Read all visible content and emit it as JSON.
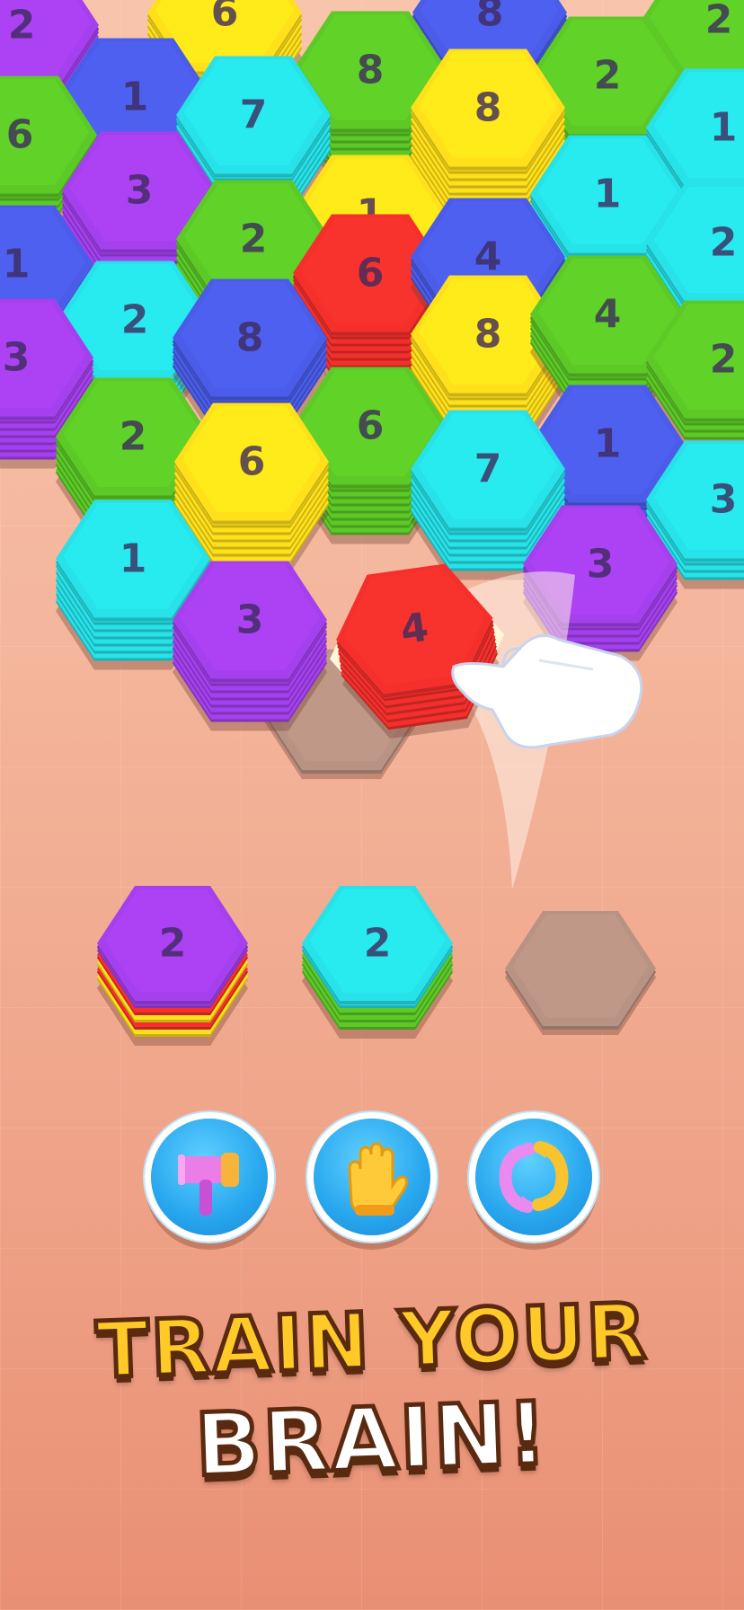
{
  "board": {
    "tiles": [
      {
        "n": "2",
        "c": "purple"
      },
      {
        "n": "6",
        "c": "yellow"
      },
      {
        "n": "8",
        "c": "blue"
      },
      {
        "n": "2",
        "c": "green"
      },
      {
        "n": "1",
        "c": "blue"
      },
      {
        "n": "8",
        "c": "green"
      },
      {
        "n": "2",
        "c": "green"
      },
      {
        "n": "6",
        "c": "green"
      },
      {
        "n": "7",
        "c": "cyan"
      },
      {
        "n": "8",
        "c": "yellow"
      },
      {
        "n": "1",
        "c": "cyan"
      },
      {
        "n": "3",
        "c": "purple"
      },
      {
        "n": "1",
        "c": "cyan"
      },
      {
        "n": "1",
        "c": "yellow"
      },
      {
        "n": "2",
        "c": "cyan"
      },
      {
        "n": "1",
        "c": "blue"
      },
      {
        "n": "2",
        "c": "green"
      },
      {
        "n": "6",
        "c": "red"
      },
      {
        "n": "4",
        "c": "blue"
      },
      {
        "n": "2",
        "c": "cyan"
      },
      {
        "n": "8",
        "c": "blue"
      },
      {
        "n": "8",
        "c": "yellow"
      },
      {
        "n": "4",
        "c": "green"
      },
      {
        "n": "3",
        "c": "purple"
      },
      {
        "n": "2",
        "c": "green"
      },
      {
        "n": "2",
        "c": "green"
      },
      {
        "n": "6",
        "c": "green"
      },
      {
        "n": "1",
        "c": "blue"
      },
      {
        "n": "6",
        "c": "yellow"
      },
      {
        "n": "7",
        "c": "cyan"
      },
      {
        "n": "3",
        "c": "cyan"
      },
      {
        "n": "1",
        "c": "cyan"
      },
      {
        "n": "3",
        "c": "purple"
      },
      {
        "n": "3",
        "c": "purple"
      }
    ],
    "dragged_tile": {
      "n": "4",
      "c": "red"
    }
  },
  "tray": [
    {
      "n": "2",
      "c": "purple"
    },
    {
      "n": "2",
      "c": "cyan"
    },
    {
      "n": "",
      "c": "empty"
    }
  ],
  "tools": [
    {
      "name": "hammer"
    },
    {
      "name": "glove"
    },
    {
      "name": "shuffle"
    }
  ],
  "headline": {
    "line1": "TRAIN YOUR",
    "line2": "BRAIN!"
  },
  "colors": {
    "purple": "#a540ee",
    "blue": "#4a5ce8",
    "green": "#5cc927",
    "cyan": "#27e2e8",
    "yellow": "#ffe01a",
    "red": "#f5302c",
    "empty": "#b89283",
    "text": "#3d2a5c"
  }
}
